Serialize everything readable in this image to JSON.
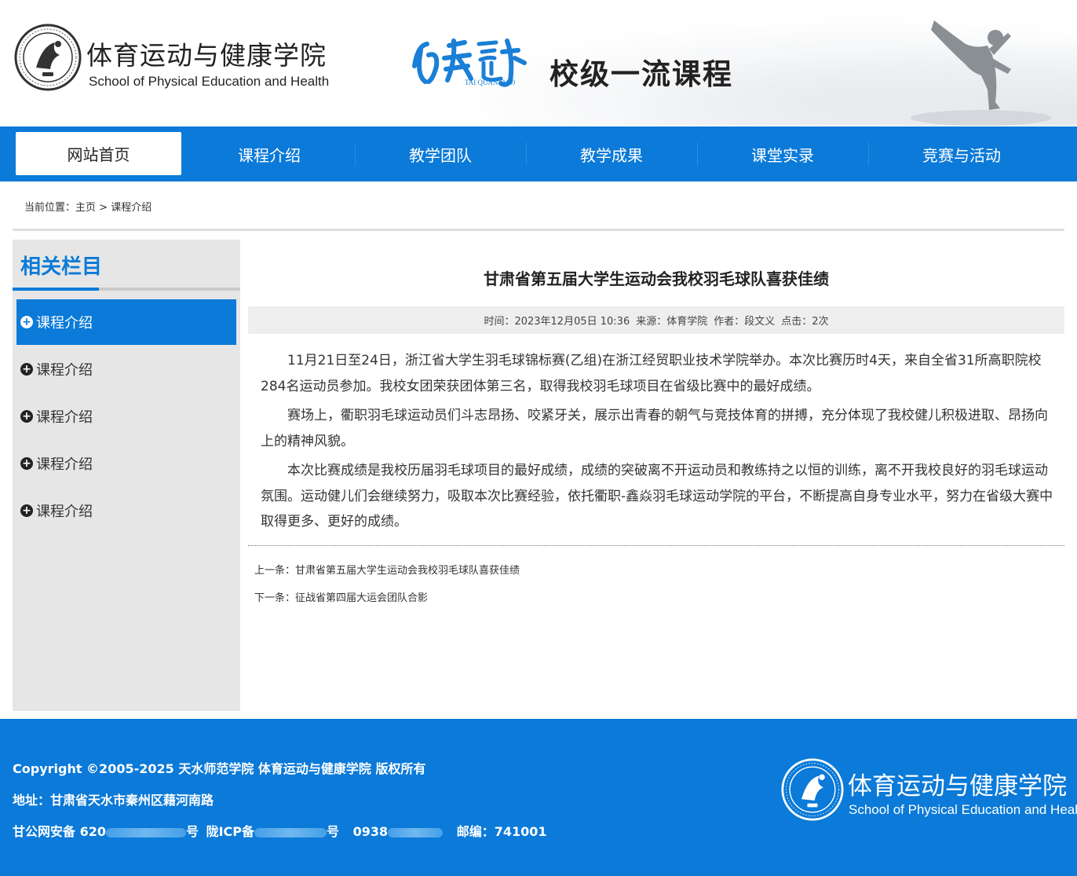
{
  "header": {
    "school_cn": "体育运动与健康学院",
    "school_en": "School of Physical Education and Health",
    "brush_en": "TAI QUAN DAO",
    "course_title": "校级一流课程"
  },
  "nav": {
    "items": [
      "网站首页",
      "课程介绍",
      "教学团队",
      "教学成果",
      "课堂实录",
      "竞赛与活动"
    ]
  },
  "breadcrumb": {
    "prefix": "当前位置：",
    "home": "主页",
    "sep": ">",
    "current": "课程介绍"
  },
  "sidebar": {
    "title": "相关栏目",
    "items": [
      "课程介绍",
      "课程介绍",
      "课程介绍",
      "课程介绍",
      "课程介绍"
    ]
  },
  "article": {
    "title": "甘肃省第五届大学生运动会我校羽毛球队喜获佳绩",
    "meta": {
      "time": "时间：2023年12月05日 10:36",
      "source": "来源：体育学院",
      "author": "作者：段文义",
      "clicks": "点击：2次"
    },
    "paragraphs": [
      "11月21日至24日，浙江省大学生羽毛球锦标赛(乙组)在浙江经贸职业技术学院举办。本次比赛历时4天，来自全省31所高职院校284名运动员参加。我校女团荣获团体第三名，取得我校羽毛球项目在省级比赛中的最好成绩。",
      "赛场上，衢职羽毛球运动员们斗志昂扬、咬紧牙关，展示出青春的朝气与竞技体育的拼搏，充分体现了我校健儿积极进取、昂扬向上的精神风貌。",
      "本次比赛成绩是我校历届羽毛球项目的最好成绩，成绩的突破离不开运动员和教练持之以恒的训练，离不开我校良好的羽毛球运动氛围。运动健儿们会继续努力，吸取本次比赛经验，依托衢职-鑫焱羽毛球运动学院的平台，不断提高自身专业水平，努力在省级大赛中取得更多、更好的成绩。"
    ],
    "prev": "上一条：甘肃省第五届大学生运动会我校羽毛球队喜获佳绩",
    "next": "下一条：征战省第四届大运会团队合影"
  },
  "footer": {
    "copyright": "Copyright ©2005-2025   天水师范学院 体育运动与健康学院 版权所有",
    "address": "地址：甘肃省天水市秦州区藉河南路",
    "gongan_prefix": "甘公网安备 620",
    "gongan_suffix": "号",
    "icp_prefix": "陇ICP备",
    "icp_suffix": "号",
    "phone_prefix": "0938",
    "postcode": "邮编：741001",
    "school_cn": "体育运动与健康学院",
    "school_en": "School of Physical Education and Health"
  },
  "colors": {
    "brand_blue": "#0b7ad8",
    "sidebar_bg": "#e6e6e6"
  },
  "icons": {
    "logo": "school-seal-icon",
    "brush": "taekwondo-calligraphy-icon",
    "kicker": "taekwondo-kick-silhouette-icon",
    "side_bullet": "plus-circle-icon"
  }
}
